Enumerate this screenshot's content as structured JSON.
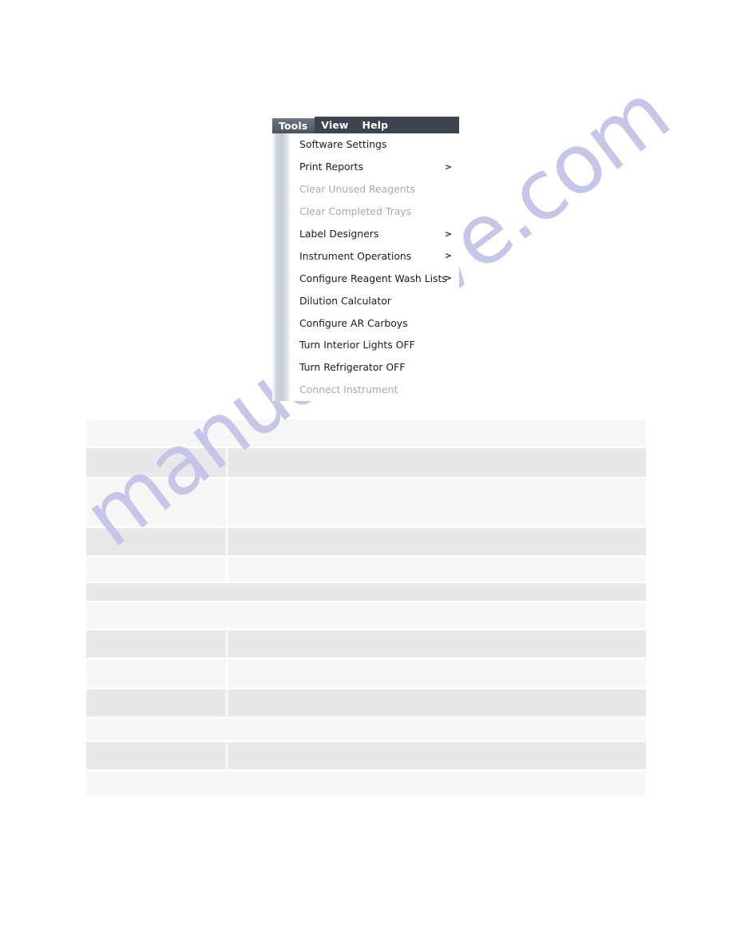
{
  "document": {
    "page_background": "#ffffff",
    "watermark_text": "manualshive.com",
    "watermark_color": "#c3c4e8"
  },
  "menu_screenshot": {
    "menubar": {
      "background_color": "#3d4450",
      "items": [
        {
          "label": "Tools",
          "selected": true
        },
        {
          "label": "View",
          "selected": false
        },
        {
          "label": "Help",
          "selected": false
        }
      ]
    },
    "dropdown": {
      "open_for": "Tools",
      "items": [
        {
          "label": "Software Settings",
          "enabled": true,
          "submenu": false,
          "arrow": ""
        },
        {
          "label": "Print Reports",
          "enabled": true,
          "submenu": true,
          "arrow": ">"
        },
        {
          "label": "Clear Unused Reagents",
          "enabled": false,
          "submenu": false,
          "arrow": ""
        },
        {
          "label": "Clear Completed Trays",
          "enabled": false,
          "submenu": false,
          "arrow": ""
        },
        {
          "label": "Label Designers",
          "enabled": true,
          "submenu": true,
          "arrow": ">"
        },
        {
          "label": "Instrument Operations",
          "enabled": true,
          "submenu": true,
          "arrow": ">"
        },
        {
          "label": "Configure Reagent Wash Lists",
          "enabled": true,
          "submenu": true,
          "arrow": ">"
        },
        {
          "label": "Dilution Calculator",
          "enabled": true,
          "submenu": false,
          "arrow": ""
        },
        {
          "label": "Configure AR Carboys",
          "enabled": true,
          "submenu": false,
          "arrow": ""
        },
        {
          "label": "Turn Interior Lights OFF",
          "enabled": true,
          "submenu": false,
          "arrow": ""
        },
        {
          "label": "Turn Refrigerator OFF",
          "enabled": true,
          "submenu": false,
          "arrow": ""
        },
        {
          "label": "Connect Instrument",
          "enabled": false,
          "submenu": false,
          "arrow": ""
        }
      ]
    }
  },
  "table": {
    "rows": [
      {
        "shade": "light",
        "height": 34,
        "split": false,
        "col_a": "",
        "col_b": "",
        "full": ""
      },
      {
        "shade": "dark",
        "height": 38,
        "split": true,
        "col_a": "",
        "col_b": ""
      },
      {
        "shade": "light",
        "height": 62,
        "split": true,
        "col_a": "",
        "col_b": ""
      },
      {
        "shade": "dark",
        "height": 36,
        "split": true,
        "col_a": "",
        "col_b": ""
      },
      {
        "shade": "light",
        "height": 33,
        "split": true,
        "col_a": "",
        "col_b": ""
      },
      {
        "shade": "dark",
        "height": 24,
        "split": false,
        "full": ""
      },
      {
        "shade": "light",
        "height": 35,
        "split": false,
        "full": ""
      },
      {
        "shade": "dark",
        "height": 36,
        "split": true,
        "col_a": "",
        "col_b": ""
      },
      {
        "shade": "light",
        "height": 38,
        "split": true,
        "col_a": "",
        "col_b": ""
      },
      {
        "shade": "dark",
        "height": 36,
        "split": true,
        "col_a": "",
        "col_b": ""
      },
      {
        "shade": "light",
        "height": 30,
        "split": false,
        "full": ""
      },
      {
        "shade": "dark",
        "height": 36,
        "split": true,
        "col_a": "",
        "col_b": ""
      },
      {
        "shade": "light",
        "height": 34,
        "split": false,
        "full": ""
      }
    ]
  }
}
